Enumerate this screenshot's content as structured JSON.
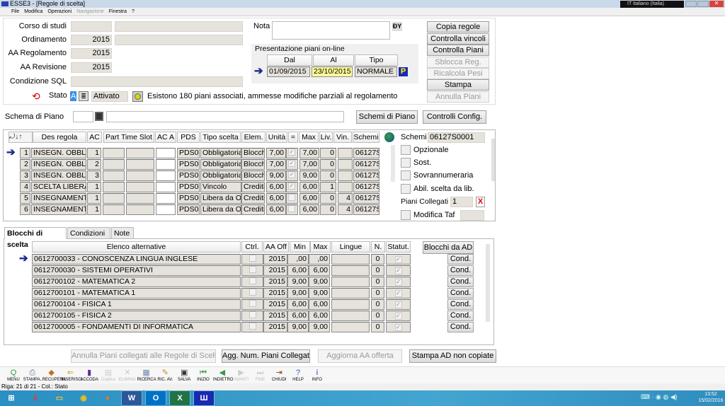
{
  "window": {
    "title": "ESSE3 - [Regole di scelta]",
    "language": "IT Italiano (Italia)"
  },
  "menu": [
    "File",
    "Modifica",
    "Operazioni",
    "Navigazione",
    "Finestra",
    "?"
  ],
  "header": {
    "corso_label": "Corso di studi",
    "corso_value": "",
    "corso_desc": "",
    "ordinamento_label": "Ordinamento",
    "ordinamento_value": "2015",
    "ordinamento_desc": "",
    "aa_reg_label": "AA Regolamento",
    "aa_reg_value": "2015",
    "aa_rev_label": "AA Revisione",
    "aa_rev_value": "2015",
    "sql_label": "Condizione SQL",
    "sql_value": "",
    "stato_label": "Stato",
    "stato_code": "A",
    "stato_value": "Attivato",
    "stato_message": "Esistono 180 piani associati, ammesse modifiche parziali al regolamento",
    "nota_label": "Nota",
    "nota_value": ""
  },
  "presentazione": {
    "title": "Presentazione piani on-line",
    "headers": [
      "Dal",
      "Al",
      "Tipo"
    ],
    "dal": "01/09/2015",
    "al": "23/10/2015",
    "tipo": "NORMALE",
    "p_badge": "P"
  },
  "side_buttons": [
    {
      "label": "Copia regole",
      "enabled": true
    },
    {
      "label": "Controlla vincoli",
      "enabled": true
    },
    {
      "label": "Controlla Piani",
      "enabled": true
    },
    {
      "label": "Sblocca Reg.",
      "enabled": false
    },
    {
      "label": "Ricalcola Pesi",
      "enabled": false
    },
    {
      "label": "Stampa",
      "enabled": true
    },
    {
      "label": "Annulla Piani",
      "enabled": false
    }
  ],
  "schema": {
    "label": "Schema di Piano",
    "code": "",
    "desc": "",
    "btn_schemi": "Schemi di Piano",
    "btn_controlli": "Controlli Config."
  },
  "rules": {
    "headers": [
      "Des regola",
      "AC",
      "Part Time Slot",
      "AC A",
      "PDS",
      "Tipo scelta",
      "Elem.",
      "Unità",
      "=",
      "Max",
      "Liv.",
      "Vin.",
      "Schemi"
    ],
    "rows": [
      {
        "n": "1",
        "des": "INSEGN. OBBL",
        "ac": "1",
        "pds": "PDS0-",
        "tipo": "Obbligatoria",
        "elem": "Blocchi",
        "unita": "7,00",
        "eq": true,
        "max": "7,00",
        "liv": "0",
        "vin": "",
        "schemi": "06127S"
      },
      {
        "n": "2",
        "des": "INSEGN. OBBL",
        "ac": "2",
        "pds": "PDS0-",
        "tipo": "Obbligatoria",
        "elem": "Blocchi",
        "unita": "7,00",
        "eq": true,
        "max": "7,00",
        "liv": "0",
        "vin": "",
        "schemi": "06127S"
      },
      {
        "n": "3",
        "des": "INSEGN. OBBL",
        "ac": "3",
        "pds": "PDS0-",
        "tipo": "Obbligatoria",
        "elem": "Blocchi",
        "unita": "9,00",
        "eq": true,
        "max": "9,00",
        "liv": "0",
        "vin": "",
        "schemi": "06127S"
      },
      {
        "n": "4",
        "des": "SCELTA LIBERA",
        "ac": "1",
        "pds": "PDS0-",
        "tipo": "Vincolo",
        "elem": "Crediti",
        "unita": "6,00",
        "eq": true,
        "max": "6,00",
        "liv": "1",
        "vin": "",
        "schemi": "06127S"
      },
      {
        "n": "5",
        "des": "INSEGNAMENT",
        "ac": "1",
        "pds": "PDS0-",
        "tipo": "Libera da O",
        "elem": "Crediti",
        "unita": "6,00",
        "eq": false,
        "max": "6,00",
        "liv": "0",
        "vin": "4",
        "schemi": "06127S"
      },
      {
        "n": "6",
        "des": "INSEGNAMENT",
        "ac": "1",
        "pds": "PDS0-",
        "tipo": "Libera da O",
        "elem": "Crediti",
        "unita": "6,00",
        "eq": false,
        "max": "6,00",
        "liv": "0",
        "vin": "4",
        "schemi": "06127S"
      }
    ]
  },
  "detail": {
    "schemi_label": "Schemi",
    "schemi_value": "06127S0001",
    "opzionale": "Opzionale",
    "sost": "Sost.",
    "sovrann": "Sovrannumeraria",
    "abil": "Abil. scelta da lib.",
    "piani_label": "Piani Collegati",
    "piani_value": "1",
    "modifica_taf": "Modifica Taf",
    "modifica_taf_value": ""
  },
  "tabs": [
    {
      "label": "Blocchi di scelta",
      "active": true
    },
    {
      "label": "Condizioni",
      "active": false
    },
    {
      "label": "Note",
      "active": false
    }
  ],
  "blocks": {
    "headers": [
      "Elenco alternative",
      "Ctrl.",
      "AA Off",
      "Min",
      "Max",
      "Lingue",
      "N.",
      "Statut."
    ],
    "btn_blocchi": "Blocchi da AD",
    "cond_label": "Cond.",
    "rows": [
      {
        "name": "0612700033 - CONOSCENZA LINGUA INGLESE",
        "ctrl": false,
        "aa": "2015",
        "min": ",00",
        "max": ",00",
        "lingue": "",
        "n": "0",
        "statut": true
      },
      {
        "name": "0612700030 - SISTEMI OPERATIVI",
        "ctrl": false,
        "aa": "2015",
        "min": "6,00",
        "max": "6,00",
        "lingue": "",
        "n": "0",
        "statut": true
      },
      {
        "name": "0612700102 - MATEMATICA 2",
        "ctrl": false,
        "aa": "2015",
        "min": "9,00",
        "max": "9,00",
        "lingue": "",
        "n": "0",
        "statut": true
      },
      {
        "name": "0612700101 - MATEMATICA 1",
        "ctrl": false,
        "aa": "2015",
        "min": "9,00",
        "max": "9,00",
        "lingue": "",
        "n": "0",
        "statut": true
      },
      {
        "name": "0612700104 - FISICA 1",
        "ctrl": false,
        "aa": "2015",
        "min": "6,00",
        "max": "6,00",
        "lingue": "",
        "n": "0",
        "statut": true
      },
      {
        "name": "0612700105 - FISICA 2",
        "ctrl": false,
        "aa": "2015",
        "min": "6,00",
        "max": "6,00",
        "lingue": "",
        "n": "0",
        "statut": true
      },
      {
        "name": "0612700005 - FONDAMENTI DI INFORMATICA",
        "ctrl": false,
        "aa": "2015",
        "min": "9,00",
        "max": "9,00",
        "lingue": "",
        "n": "0",
        "statut": true
      }
    ]
  },
  "bottom_buttons": [
    {
      "label": "Annulla Piani collegati alle Regole di Scelta",
      "enabled": false
    },
    {
      "label": "Agg. Num. Piani Collegati",
      "enabled": true
    },
    {
      "label": "Aggiorna AA offerta",
      "enabled": false
    },
    {
      "label": "Stampa AD non copiate",
      "enabled": true
    }
  ],
  "toolbar": [
    {
      "label": "MENU",
      "icon": "menu-icon",
      "enabled": true
    },
    {
      "label": "STAMPA..",
      "icon": "print-icon",
      "enabled": true
    },
    {
      "label": "RECUPERA",
      "icon": "retrieve-icon",
      "enabled": true
    },
    {
      "label": "INSERISCI",
      "icon": "insert-icon",
      "enabled": true
    },
    {
      "label": "ACCODA",
      "icon": "append-icon",
      "enabled": true
    },
    {
      "label": "Duplica",
      "icon": "duplicate-icon",
      "enabled": false
    },
    {
      "label": "ELIMINA",
      "icon": "delete-icon",
      "enabled": false
    },
    {
      "label": "RICERCA",
      "icon": "search-icon",
      "enabled": true
    },
    {
      "label": "RIC. AV.",
      "icon": "advanced-search-icon",
      "enabled": true
    },
    {
      "label": "SALVA",
      "icon": "save-icon",
      "enabled": true
    },
    {
      "label": "INIZIO",
      "icon": "first-icon",
      "enabled": true
    },
    {
      "label": "INDIETRO",
      "icon": "back-icon",
      "enabled": true
    },
    {
      "label": "AVANTI",
      "icon": "forward-icon",
      "enabled": false
    },
    {
      "label": "FINE",
      "icon": "last-icon",
      "enabled": false
    },
    {
      "label": "CHIUDI",
      "icon": "exit-icon",
      "enabled": true
    },
    {
      "label": "HELP",
      "icon": "help-icon",
      "enabled": true
    },
    {
      "label": "INFO",
      "icon": "info-icon",
      "enabled": true
    }
  ],
  "status": "Riga: 21 di 21 - Col.: Stato",
  "taskbar": {
    "apps": [
      "windows-start",
      "acrobat",
      "explorer",
      "chrome",
      "firefox",
      "word",
      "outlook",
      "excel",
      "esse3"
    ],
    "time": "13:52",
    "date": "15/02/2016"
  }
}
